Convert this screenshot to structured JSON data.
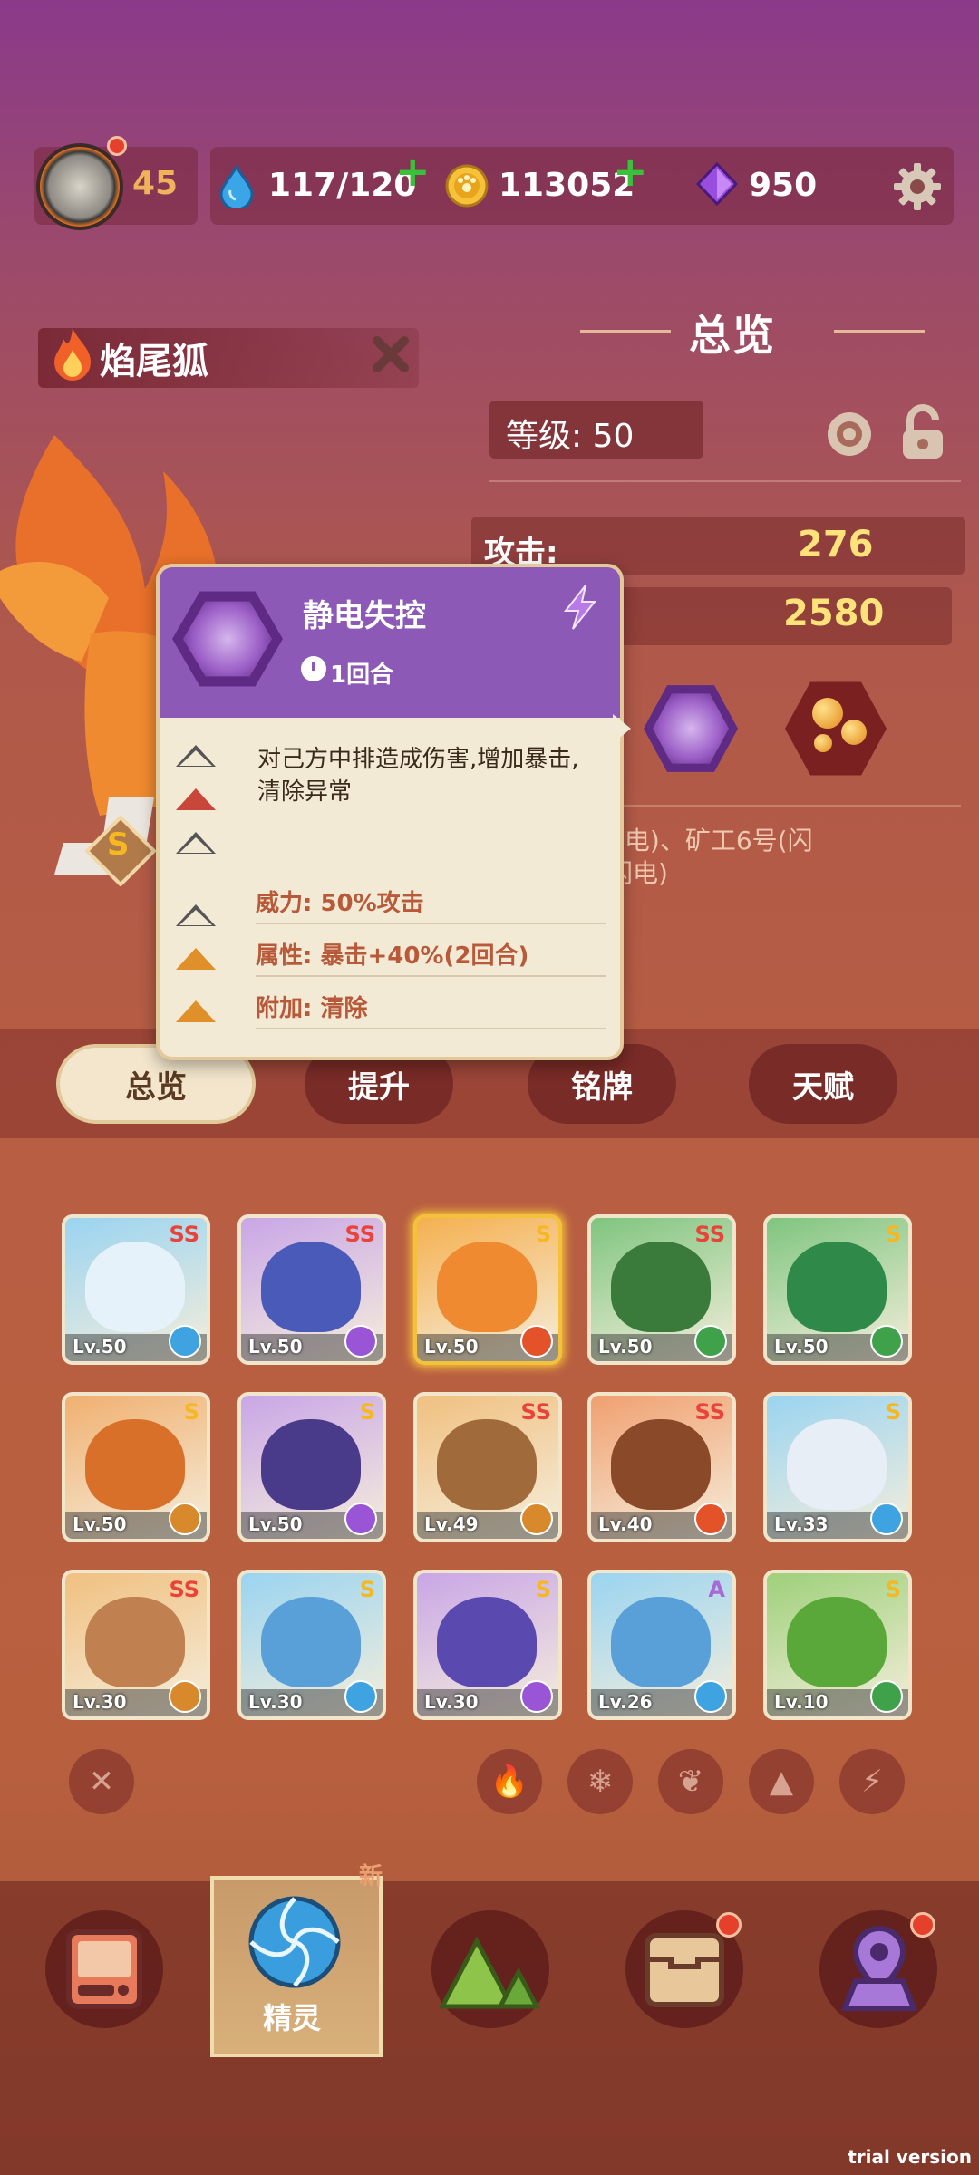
{
  "top_bar": {
    "player_level": "45",
    "energy": "117/120",
    "gold": "113052",
    "gems": "950"
  },
  "creature": {
    "name": "焰尾狐",
    "grade": "S"
  },
  "overview": {
    "title": "总览",
    "level_label": "等级: 50",
    "attack_label": "攻击:",
    "attack_value": "276",
    "hp_value": "2580",
    "description_tail": "(闪电)、矿工6号(闪",
    "description_tail2": "闪电)"
  },
  "skill_tooltip": {
    "title": "静电失控",
    "duration": "1回合",
    "description": "对己方中排造成伤害,增加暴击,清除异常",
    "power": "威力: 50%攻击",
    "attribute": "属性: 暴击+40%(2回合)",
    "extra": "附加: 清除"
  },
  "tabs": [
    "总览",
    "提升",
    "铭牌",
    "天赋"
  ],
  "creatures": [
    {
      "rarity": "SS",
      "level": "Lv.50",
      "element": "ice"
    },
    {
      "rarity": "SS",
      "level": "Lv.50",
      "element": "lightning"
    },
    {
      "rarity": "S",
      "level": "Lv.50",
      "element": "fire"
    },
    {
      "rarity": "SS",
      "level": "Lv.50",
      "element": "grass"
    },
    {
      "rarity": "S",
      "level": "Lv.50",
      "element": "grass"
    },
    {
      "rarity": "S",
      "level": "Lv.50",
      "element": "earth"
    },
    {
      "rarity": "S",
      "level": "Lv.50",
      "element": "lightning"
    },
    {
      "rarity": "SS",
      "level": "Lv.49",
      "element": "earth"
    },
    {
      "rarity": "SS",
      "level": "Lv.40",
      "element": "fire"
    },
    {
      "rarity": "S",
      "level": "Lv.33",
      "element": "ice"
    },
    {
      "rarity": "SS",
      "level": "Lv.30",
      "element": "earth"
    },
    {
      "rarity": "S",
      "level": "Lv.30",
      "element": "ice"
    },
    {
      "rarity": "S",
      "level": "Lv.30",
      "element": "lightning"
    },
    {
      "rarity": "A",
      "level": "Lv.26",
      "element": "ice"
    },
    {
      "rarity": "S",
      "level": "Lv.10",
      "element": "grass"
    }
  ],
  "bottom_nav": {
    "active_label": "精灵",
    "new_badge": "新"
  },
  "watermark": "trial version",
  "colors": {
    "rarity_ss": "#e9433a",
    "rarity_s": "#f5b722",
    "rarity_a": "#a66ad6",
    "fire": "#e4522a",
    "ice": "#3ea3e0",
    "lightning": "#9a55d6",
    "grass": "#3fa24a",
    "earth": "#d8892c"
  }
}
